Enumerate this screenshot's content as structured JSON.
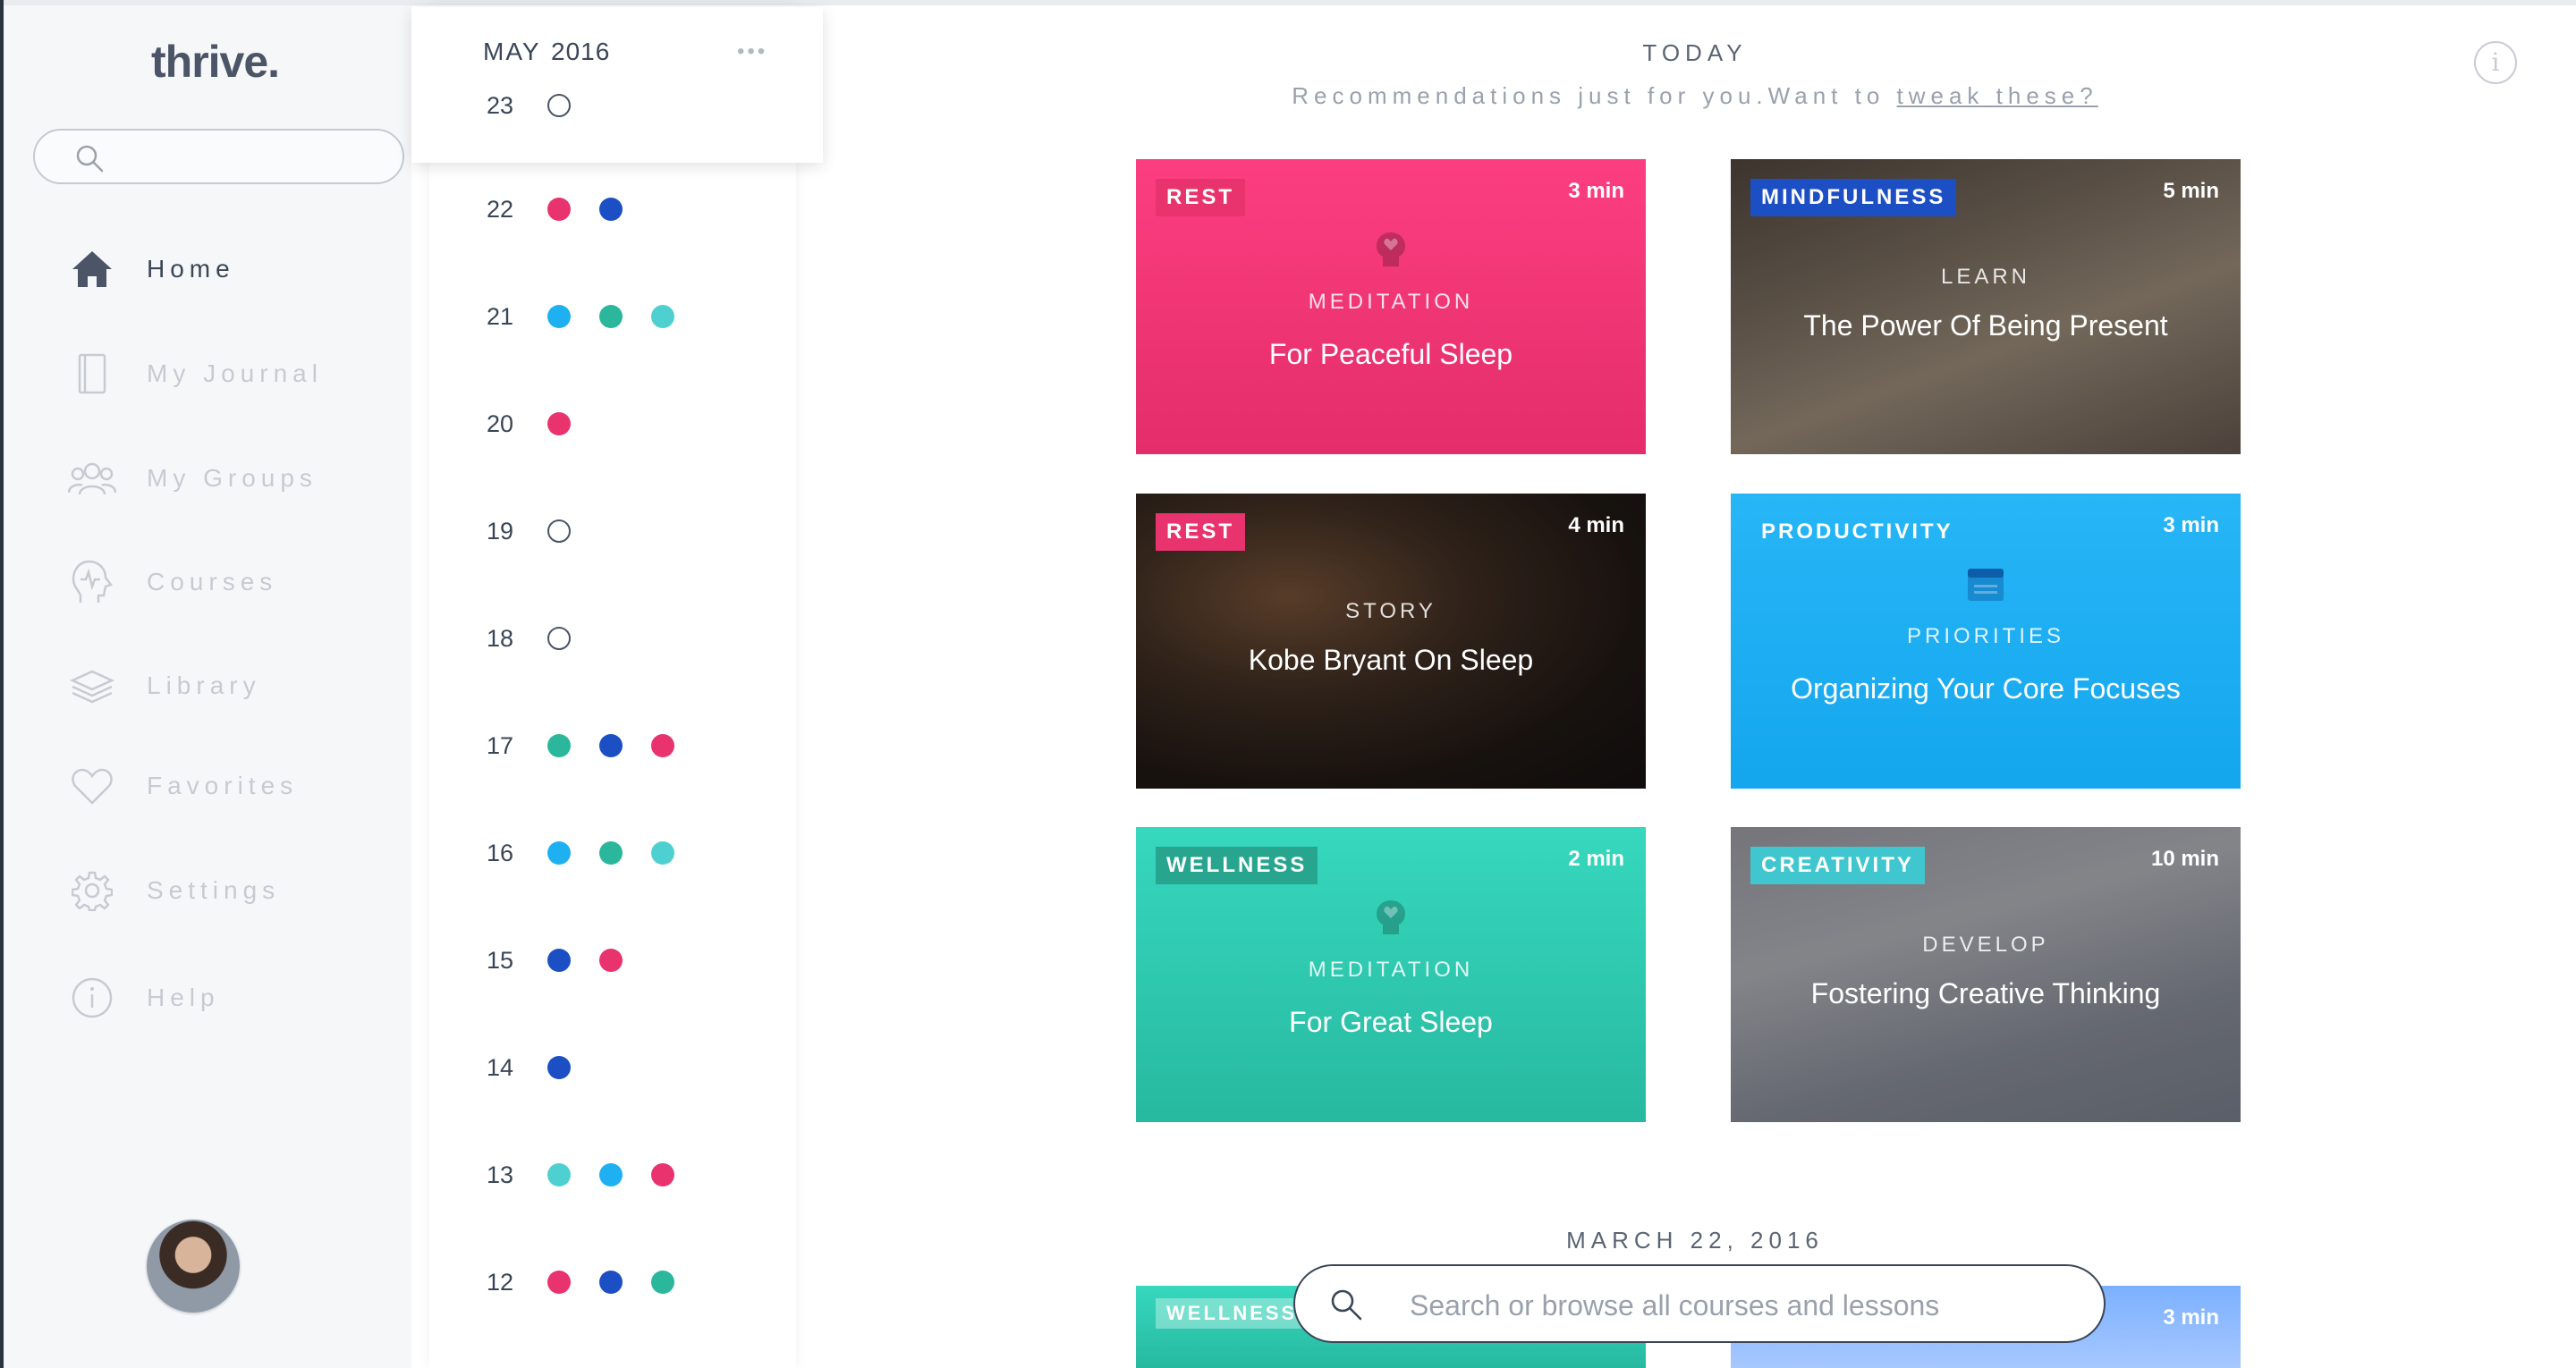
{
  "app": {
    "logo": "thrive."
  },
  "sidebar": {
    "search_placeholder": "",
    "items": [
      {
        "label": "Home",
        "icon": "home-icon",
        "active": true
      },
      {
        "label": "My Journal",
        "icon": "journal-icon",
        "active": false
      },
      {
        "label": "My Groups",
        "icon": "groups-icon",
        "active": false
      },
      {
        "label": "Courses",
        "icon": "courses-icon",
        "active": false
      },
      {
        "label": "Library",
        "icon": "library-icon",
        "active": false
      },
      {
        "label": "Favorites",
        "icon": "heart-icon",
        "active": false
      },
      {
        "label": "Settings",
        "icon": "gear-icon",
        "active": false
      },
      {
        "label": "Help",
        "icon": "info-icon",
        "active": false
      }
    ]
  },
  "calendar": {
    "month": "MAY",
    "year": "2016",
    "more": "•••",
    "days": [
      {
        "day": "23",
        "dots": [
          "empty"
        ]
      },
      {
        "day": "22",
        "dots": [
          "#e8336e",
          "#1d4fc4"
        ]
      },
      {
        "day": "21",
        "dots": [
          "#1fb0f2",
          "#2bb79c",
          "#4fd0d0"
        ]
      },
      {
        "day": "20",
        "dots": [
          "#e8336e"
        ]
      },
      {
        "day": "19",
        "dots": [
          "empty"
        ]
      },
      {
        "day": "18",
        "dots": [
          "empty"
        ]
      },
      {
        "day": "17",
        "dots": [
          "#2bb79c",
          "#1d4fc4",
          "#e8336e"
        ]
      },
      {
        "day": "16",
        "dots": [
          "#1fb0f2",
          "#2bb79c",
          "#4fd0d0"
        ]
      },
      {
        "day": "15",
        "dots": [
          "#1d4fc4",
          "#e8336e"
        ]
      },
      {
        "day": "14",
        "dots": [
          "#1d4fc4"
        ]
      },
      {
        "day": "13",
        "dots": [
          "#4fd0d0",
          "#1fb0f2",
          "#e8336e"
        ]
      },
      {
        "day": "12",
        "dots": [
          "#e8336e",
          "#1d4fc4",
          "#2bb79c"
        ]
      }
    ]
  },
  "main": {
    "heading": "TODAY",
    "reco_text": "Recommendations just for you.Want to ",
    "reco_link": "tweak these?",
    "info_glyph": "i",
    "cards": [
      {
        "tag": "REST",
        "tag_color": "#e8336e",
        "duration": "3 min",
        "kind": "MEDITATION",
        "title": "For Peaceful Sleep",
        "icon": "meditation-icon",
        "style": "c-rest"
      },
      {
        "tag": "MINDFULNESS",
        "tag_color": "#1d4fc4",
        "duration": "5 min",
        "kind": "LEARN",
        "title": "The Power Of Being Present",
        "icon": "",
        "style": "c-mind"
      },
      {
        "tag": "REST",
        "tag_color": "#e8336e",
        "duration": "4 min",
        "kind": "STORY",
        "title": "Kobe Bryant On Sleep",
        "icon": "",
        "style": "c-kobe"
      },
      {
        "tag": "PRODUCTIVITY",
        "tag_color": "transparent",
        "duration": "3 min",
        "kind": "PRIORITIES",
        "title": "Organizing Your Core Focuses",
        "icon": "priorities-icon",
        "style": "c-prod"
      },
      {
        "tag": "WELLNESS",
        "tag_color": "#27a58f",
        "duration": "2 min",
        "kind": "MEDITATION",
        "title": "For Great Sleep",
        "icon": "meditation-icon",
        "style": "c-well"
      },
      {
        "tag": "CREATIVITY",
        "tag_color": "#3fc6cf",
        "duration": "10 min",
        "kind": "DEVELOP",
        "title": "Fostering Creative Thinking",
        "icon": "",
        "style": "c-crea"
      }
    ],
    "section2_heading": "MARCH 22, 2016",
    "peek_cards": [
      {
        "tag": "WELLNESS",
        "duration": ""
      },
      {
        "tag": "",
        "duration": "3 min"
      }
    ]
  },
  "search": {
    "placeholder": "Search or browse all courses and lessons"
  }
}
